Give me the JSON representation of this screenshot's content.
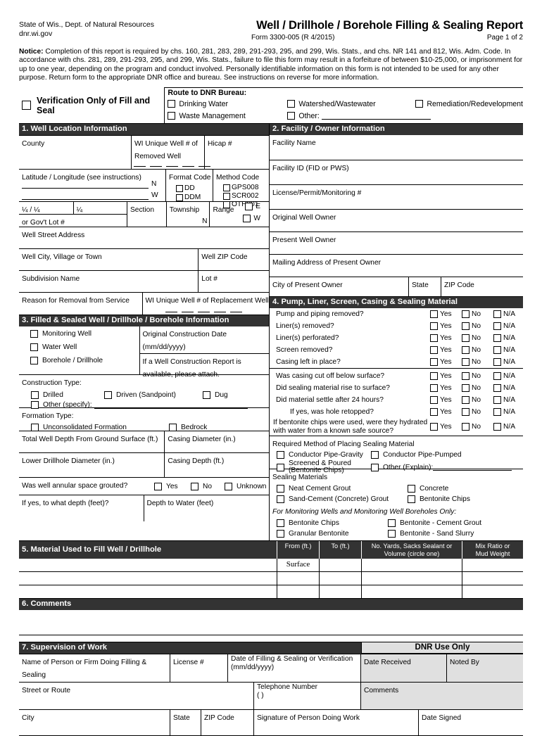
{
  "header": {
    "agency_line1": "State of Wis., Dept. of Natural Resources",
    "agency_line2": "dnr.wi.gov",
    "title": "Well / Drillhole / Borehole Filling & Sealing Report",
    "form_number": "Form 3300-005  (R 4/2015)",
    "page": "Page 1 of 2",
    "notice_bold": "Notice:",
    "notice_text": " Completion of this report is required by chs. 160, 281, 283, 289, 291-293, 295, and 299, Wis. Stats., and chs. NR 141 and 812, Wis. Adm. Code. In accordance with chs. 281, 289, 291-293, 295, and 299, Wis. Stats., failure to file this form may result in a forfeiture of between $10-25,000, or imprisonment for up to one year, depending on the program and conduct involved. Personally identifiable information on this form is not intended to be used for any other purpose. Return form to the appropriate DNR office and bureau. See instructions on reverse for more information."
  },
  "verification": {
    "label": "Verification Only of Fill and Seal"
  },
  "route": {
    "title": "Route to DNR Bureau:",
    "opt_drinking_water": "Drinking Water",
    "opt_watershed": "Watershed/Wastewater",
    "opt_remediation": "Remediation/Redevelopment",
    "opt_waste": "Waste Management",
    "opt_other": "Other:"
  },
  "section1": {
    "title": "1. Well Location Information",
    "county": "County",
    "wi_unique_well": "WI Unique Well # of Removed Well",
    "hicap": "Hicap #",
    "lat_long": "Latitude / Longitude (see instructions)",
    "n": "N",
    "w": "W",
    "format_code": "Format Code",
    "fc_dd": "DD",
    "fc_ddm": "DDM",
    "method_code": "Method Code",
    "mc_gps": "GPS008",
    "mc_scr": "SCR002",
    "mc_oth": "OTH001",
    "quarter_quarter": "¼ / ¼",
    "gov_lot": "or Gov't Lot #",
    "quarter": "¼",
    "section": "Section",
    "township": "Township",
    "township_n": "N",
    "range": "Range",
    "range_e": "E",
    "range_w": "W",
    "street_address": "Well Street Address",
    "city": "Well City, Village or Town",
    "zip": "Well ZIP Code",
    "subdivision": "Subdivision Name",
    "lot": "Lot #",
    "reason_removal": "Reason for Removal from Service",
    "replacement_well": "WI Unique Well # of Replacement Well"
  },
  "section2": {
    "title": "2. Facility / Owner Information",
    "facility_name": "Facility Name",
    "facility_id": "Facility ID (FID or PWS)",
    "license": "License/Permit/Monitoring #",
    "original_owner": "Original Well Owner",
    "present_owner": "Present Well Owner",
    "mailing_address": "Mailing Address of Present Owner",
    "city": "City of Present Owner",
    "state": "State",
    "zip": "ZIP Code"
  },
  "section3": {
    "title": "3. Filled & Sealed Well / Drillhole / Borehole Information",
    "monitoring_well": "Monitoring Well",
    "water_well": "Water Well",
    "borehole": "Borehole / Drillhole",
    "original_construction_date": "Original Construction Date (mm/dd/yyyy)",
    "attach_note": "If a Well Construction Report is available, please attach.",
    "construction_type": "Construction Type:",
    "ct_drilled": "Drilled",
    "ct_driven": "Driven (Sandpoint)",
    "ct_dug": "Dug",
    "ct_other": "Other (specify):",
    "formation_type": "Formation Type:",
    "ft_unconsolidated": "Unconsolidated Formation",
    "ft_bedrock": "Bedrock",
    "total_depth": "Total Well Depth From Ground Surface (ft.)",
    "casing_diameter": "Casing Diameter (in.)",
    "lower_drillhole_diameter": "Lower Drillhole Diameter (in.)",
    "casing_depth": "Casing Depth (ft.)",
    "grouted_question": "Was well annular space grouted?",
    "grouted_yes": "Yes",
    "grouted_no": "No",
    "grouted_unknown": "Unknown",
    "grout_depth": "If yes, to what depth (feet)?",
    "depth_to_water": "Depth to Water (feet)"
  },
  "section4": {
    "title": "4. Pump, Liner, Screen, Casing & Sealing Material",
    "yes": "Yes",
    "no": "No",
    "na": "N/A",
    "questions_group1": [
      "Pump and piping removed?",
      "Liner(s) removed?",
      "Liner(s) perforated?",
      "Screen removed?",
      "Casing left in place?"
    ],
    "questions_group2": [
      "Was casing cut off below surface?",
      "Did sealing material rise to surface?",
      "Did material settle after 24 hours?"
    ],
    "question_indent": "If yes, was hole retopped?",
    "question_bentonite_l1": "If bentonite chips were used, were they hydrated",
    "question_bentonite_l2": "with water from a known safe source?",
    "required_method_title": "Required Method of Placing Sealing Material",
    "rm_gravity": "Conductor Pipe-Gravity",
    "rm_pumped": "Conductor Pipe-Pumped",
    "rm_screened_l1": "Screened & Poured",
    "rm_screened_l2": "(Bentonite Chips)",
    "rm_other": "Other (Explain):",
    "sealing_materials_title": "Sealing Materials",
    "sm_neat": "Neat Cement Grout",
    "sm_concrete": "Concrete",
    "sm_sand_cement": "Sand-Cement (Concrete) Grout",
    "sm_bentonite_chips": "Bentonite Chips",
    "monitoring_only_title": "For Monitoring Wells and Monitoring Well Boreholes Only:",
    "mo_bentonite_chips": "Bentonite Chips",
    "mo_bentonite_cement": "Bentonite - Cement Grout",
    "mo_granular": "Granular Bentonite",
    "mo_sand_slurry": "Bentonite - Sand Slurry"
  },
  "section5": {
    "title": "5. Material Used to Fill Well / Drillhole",
    "col_from": "From (ft.)",
    "col_to": "To (ft.)",
    "col_volume_l1": "No. Yards, Sacks Sealant or",
    "col_volume_l2": "Volume (circle one)",
    "col_mix_l1": "Mix Ratio or",
    "col_mix_l2": "Mud Weight",
    "first_from_value": "Surface"
  },
  "section6": {
    "title": "6. Comments"
  },
  "section7": {
    "title": "7. Supervision of Work",
    "name_person": "Name of Person or Firm Doing Filling & Sealing",
    "license": "License #",
    "date_filling_l1": "Date of Filling & Sealing or Verification",
    "date_filling_l2": "(mm/dd/yyyy)",
    "street": "Street or Route",
    "telephone": "Telephone Number",
    "telephone_parens": "(          )",
    "city": "City",
    "state": "State",
    "zip": "ZIP Code",
    "signature": "Signature of Person Doing Work",
    "date_signed": "Date Signed"
  },
  "dnr_use": {
    "title": "DNR Use Only",
    "date_received": "Date Received",
    "noted_by": "Noted By",
    "comments": "Comments"
  }
}
